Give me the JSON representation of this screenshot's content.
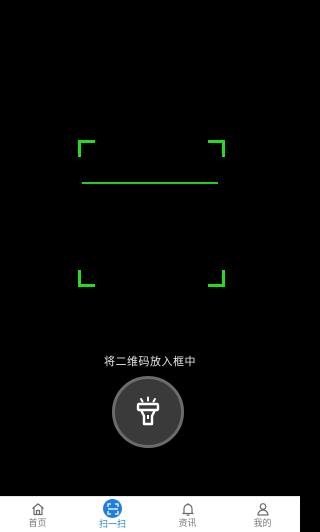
{
  "scanner": {
    "hint": "将二维码放入框中",
    "frame_color": "#22dd22",
    "torch_icon": "flashlight-icon"
  },
  "tabbar": {
    "active_color": "#1e7fe0",
    "items": [
      {
        "label": "首页",
        "icon": "home-icon"
      },
      {
        "label": "扫一扫",
        "icon": "scan-icon",
        "active": true
      },
      {
        "label": "资讯",
        "icon": "bell-icon"
      },
      {
        "label": "我的",
        "icon": "user-icon"
      }
    ]
  }
}
